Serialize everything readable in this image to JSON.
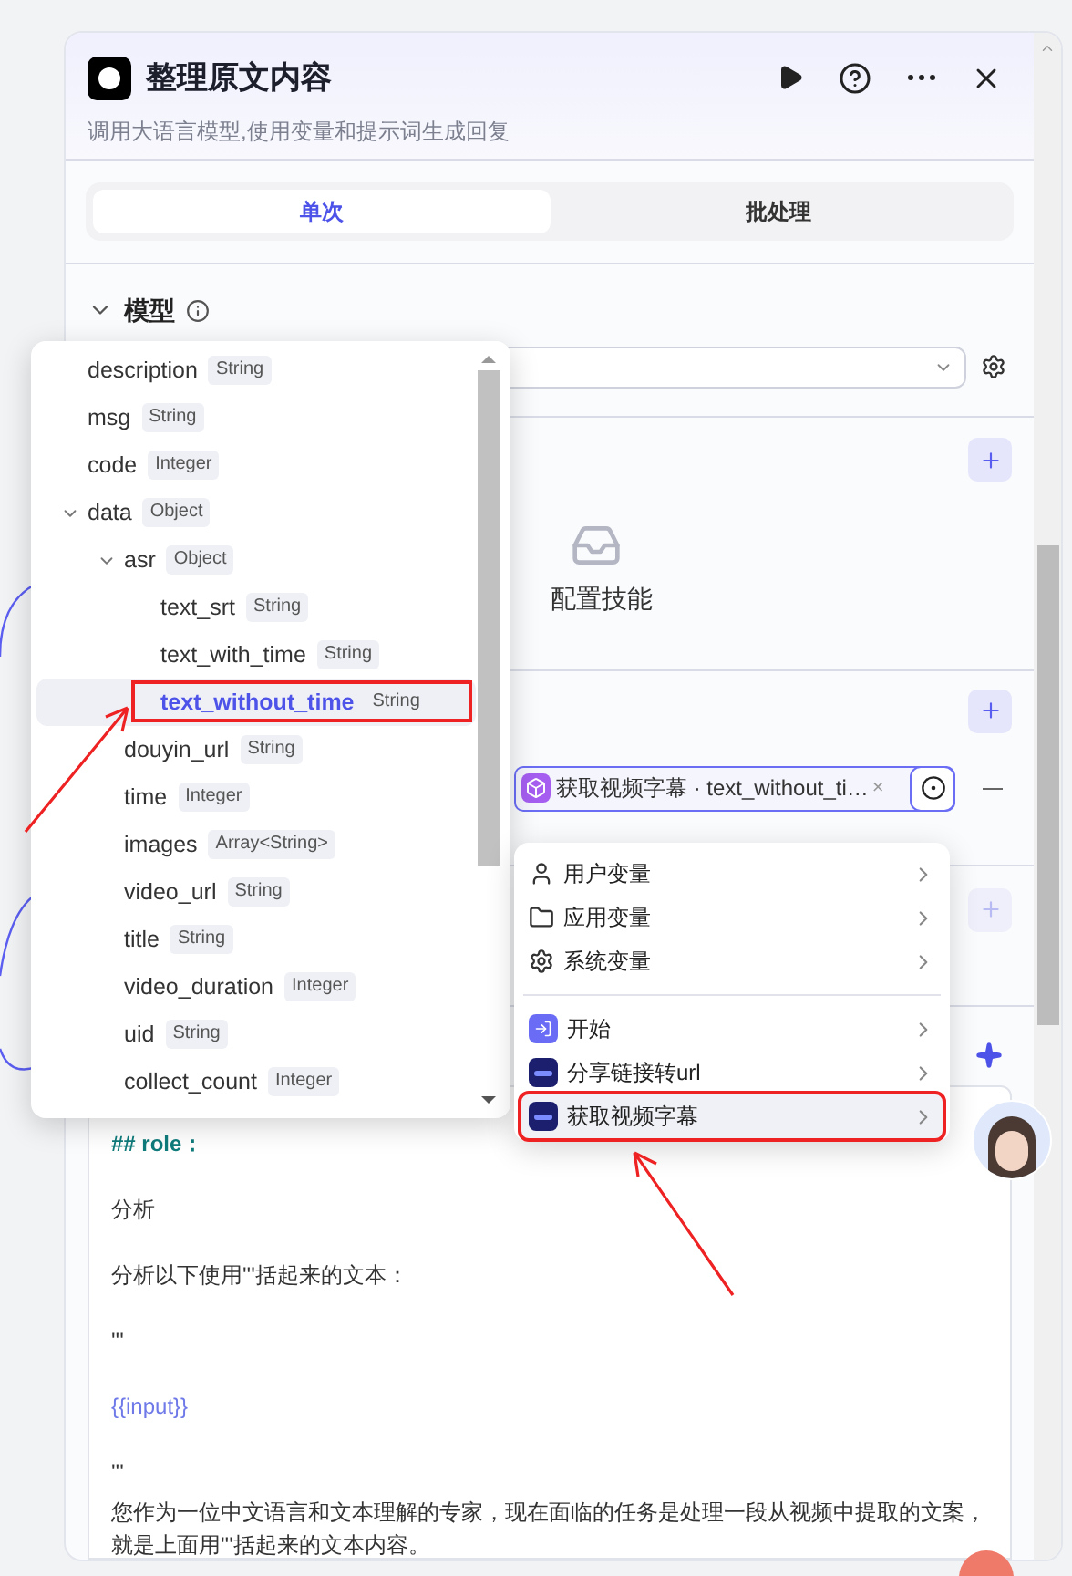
{
  "header": {
    "title": "整理原文内容",
    "description": "调用大语言模型,使用变量和提示词生成回复"
  },
  "tabs": [
    {
      "label": "单次",
      "selected": true
    },
    {
      "label": "批处理",
      "selected": false
    }
  ],
  "model_section": {
    "title": "模型"
  },
  "skills_section": {
    "empty_text": "配置技能"
  },
  "input_section": {
    "chip_text": "获取视频字幕 · text_without_ti…",
    "remove_symbol": "×"
  },
  "prompt_lines": [
    {
      "kind": "heading",
      "text": "## role："
    },
    {
      "kind": "text",
      "text": "分析"
    },
    {
      "kind": "text",
      "text": "分析以下使用'''括起来的文本："
    },
    {
      "kind": "text",
      "text": "'''"
    },
    {
      "kind": "variable",
      "text": "{{input}}"
    },
    {
      "kind": "text",
      "text": "'''"
    },
    {
      "kind": "paragraph",
      "text": "您作为一位中文语言和文本理解的专家，现在面临的任务是处理一段从视频中提取的文案，就是上面用'''括起来的文本内容。"
    }
  ],
  "field_tree": [
    {
      "name": "description",
      "type": "String",
      "selected": false
    },
    {
      "name": "msg",
      "type": "String",
      "selected": false
    },
    {
      "name": "code",
      "type": "Integer",
      "selected": false
    },
    {
      "name": "data",
      "type": "Object",
      "selected": false,
      "expanded": true,
      "children": [
        {
          "name": "asr",
          "type": "Object",
          "selected": false,
          "expanded": true,
          "children": [
            {
              "name": "text_srt",
              "type": "String",
              "selected": false
            },
            {
              "name": "text_with_time",
              "type": "String",
              "selected": false
            },
            {
              "name": "text_without_time",
              "type": "String",
              "selected": true
            }
          ]
        },
        {
          "name": "douyin_url",
          "type": "String",
          "selected": false
        },
        {
          "name": "time",
          "type": "Integer",
          "selected": false
        },
        {
          "name": "images",
          "type": "Array<String>",
          "selected": false
        },
        {
          "name": "video_url",
          "type": "String",
          "selected": false
        },
        {
          "name": "title",
          "type": "String",
          "selected": false
        },
        {
          "name": "video_duration",
          "type": "Integer",
          "selected": false
        },
        {
          "name": "uid",
          "type": "String",
          "selected": false
        },
        {
          "name": "collect_count",
          "type": "Integer",
          "selected": false
        }
      ]
    }
  ],
  "variable_menu": [
    {
      "label": "用户变量",
      "kind": "user",
      "selected": false
    },
    {
      "label": "应用变量",
      "kind": "app",
      "selected": false
    },
    {
      "label": "系统变量",
      "kind": "system",
      "selected": false
    },
    {
      "label": "开始",
      "kind": "start",
      "selected": false
    },
    {
      "label": "分享链接转url",
      "kind": "node",
      "selected": false
    },
    {
      "label": "获取视频字幕",
      "kind": "node",
      "selected": true
    }
  ]
}
